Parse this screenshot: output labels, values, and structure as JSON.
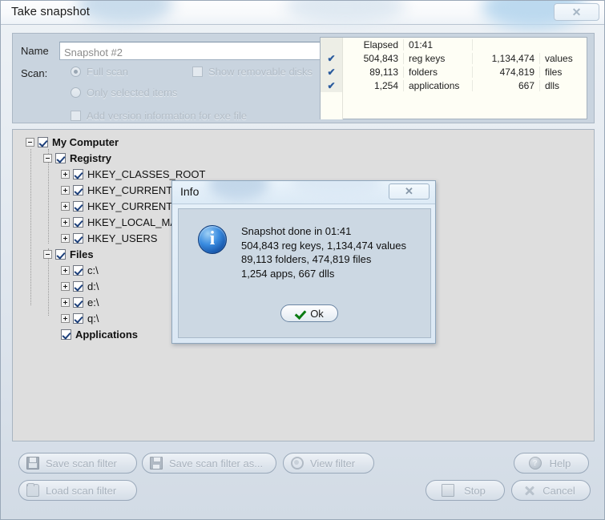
{
  "window": {
    "title": "Take snapshot",
    "close_label": "✕"
  },
  "form": {
    "name_label": "Name",
    "name_value": "Snapshot #2",
    "scan_label": "Scan:",
    "radio_full_scan": "Full scan",
    "radio_only_selected": "Only selected items",
    "checkbox_removable": "Show removable disks",
    "checkbox_version_info": "Add version information for exe file"
  },
  "stats": {
    "rows": [
      {
        "check": "",
        "num1": "Elapsed",
        "lbl1": "01:41",
        "num2": "",
        "lbl2": ""
      },
      {
        "check": "✔",
        "num1": "504,843",
        "lbl1": "reg keys",
        "num2": "1,134,474",
        "lbl2": "values"
      },
      {
        "check": "✔",
        "num1": "89,113",
        "lbl1": "folders",
        "num2": "474,819",
        "lbl2": "files"
      },
      {
        "check": "✔",
        "num1": "1,254",
        "lbl1": "applications",
        "num2": "667",
        "lbl2": "dlls"
      },
      {
        "check": "",
        "num1": "",
        "lbl1": "",
        "num2": "",
        "lbl2": ""
      },
      {
        "check": "",
        "num1": "",
        "lbl1": "",
        "num2": "",
        "lbl2": ""
      }
    ]
  },
  "tree": {
    "nodes": [
      {
        "label": "My Computer",
        "indent": 0,
        "expander": "minus",
        "checked": true,
        "bold": true
      },
      {
        "label": "Registry",
        "indent": 1,
        "expander": "minus",
        "checked": true,
        "bold": true
      },
      {
        "label": "HKEY_CLASSES_ROOT",
        "indent": 2,
        "expander": "plus",
        "checked": true,
        "bold": false
      },
      {
        "label": "HKEY_CURRENT_CONFIG",
        "indent": 2,
        "expander": "plus",
        "checked": true,
        "bold": false
      },
      {
        "label": "HKEY_CURRENT_USER",
        "indent": 2,
        "expander": "plus",
        "checked": true,
        "bold": false
      },
      {
        "label": "HKEY_LOCAL_MACHINE",
        "indent": 2,
        "expander": "plus",
        "checked": true,
        "bold": false
      },
      {
        "label": "HKEY_USERS",
        "indent": 2,
        "expander": "plus",
        "checked": true,
        "bold": false
      },
      {
        "label": "Files",
        "indent": 1,
        "expander": "minus",
        "checked": true,
        "bold": true
      },
      {
        "label": "c:\\",
        "indent": 2,
        "expander": "plus",
        "checked": true,
        "bold": false
      },
      {
        "label": "d:\\",
        "indent": 2,
        "expander": "plus",
        "checked": true,
        "bold": false
      },
      {
        "label": "e:\\",
        "indent": 2,
        "expander": "plus",
        "checked": true,
        "bold": false
      },
      {
        "label": "q:\\",
        "indent": 2,
        "expander": "plus",
        "checked": true,
        "bold": false
      },
      {
        "label": "Applications",
        "indent": 2,
        "expander": "none",
        "checked": true,
        "bold": true
      }
    ]
  },
  "info_dialog": {
    "title": "Info",
    "close_label": "✕",
    "icon": "info-icon",
    "line1": "Snapshot done in 01:41",
    "line2": "504,843 reg keys, 1,134,474 values",
    "line3": "89,113 folders, 474,819 files",
    "line4": "1,254 apps, 667 dlls",
    "ok_label": "Ok"
  },
  "buttons": {
    "save_scan_filter": "Save scan filter",
    "save_scan_filter_as": "Save scan filter as...",
    "view_filter": "View filter",
    "load_scan_filter": "Load scan filter",
    "help": "Help",
    "stop": "Stop",
    "cancel": "Cancel"
  },
  "colors": {
    "panel": "#c9d4df",
    "tree_bg": "#dedede",
    "stats_bg": "#fefef5",
    "accent_check": "#2a5b9e",
    "ok_check": "#0a7b12",
    "disabled_text": "#b2bcc6"
  }
}
